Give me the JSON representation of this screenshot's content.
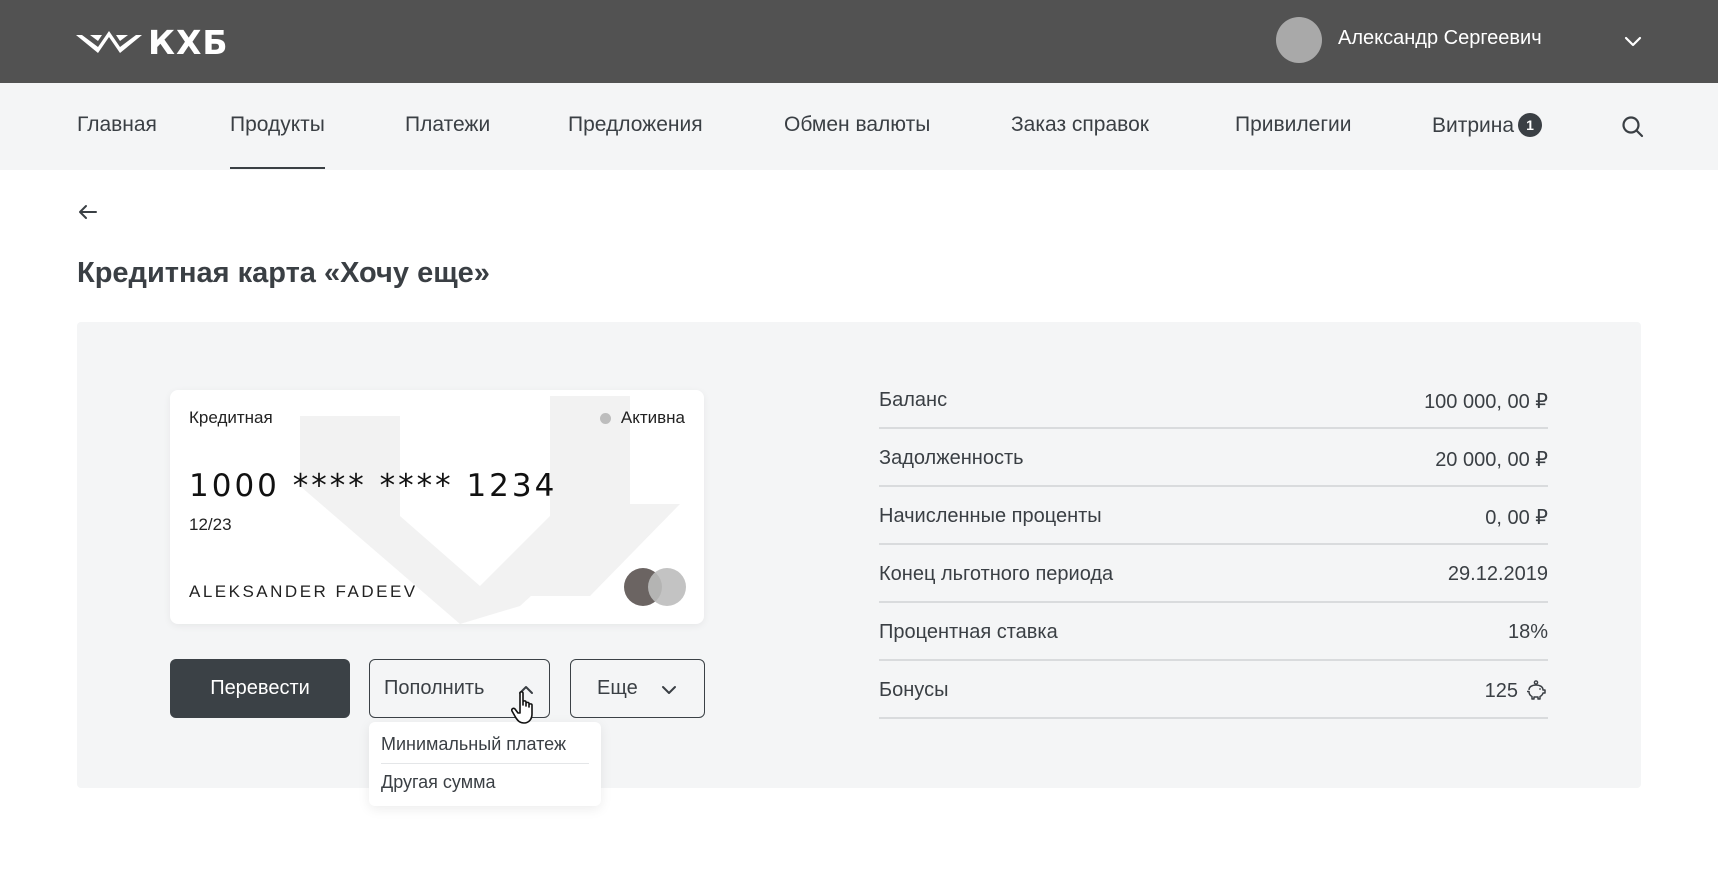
{
  "header": {
    "logo_text": "КХБ",
    "user_name": "Александр Сергеевич"
  },
  "nav": {
    "items": [
      {
        "label": "Главная"
      },
      {
        "label": "Продукты"
      },
      {
        "label": "Платежи"
      },
      {
        "label": "Предложения"
      },
      {
        "label": "Обмен валюты"
      },
      {
        "label": "Заказ справок"
      },
      {
        "label": "Привилегии"
      },
      {
        "label": "Витрина"
      }
    ],
    "showcase_badge": "1",
    "active": "Продукты"
  },
  "page": {
    "title": "Кредитная карта «Хочу еще»"
  },
  "card": {
    "type": "Кредитная",
    "status": "Активна",
    "number": "1000 **** **** 1234",
    "expiry": "12/23",
    "holder": "ALEKSANDER FADEEV",
    "payment_system_icon": "mastercard-icon"
  },
  "actions": {
    "transfer": "Перевести",
    "top_up": "Пополнить",
    "more": "Еще"
  },
  "top_up_menu": {
    "items": [
      "Минимальный платеж",
      "Другая сумма"
    ]
  },
  "info": {
    "rows": [
      {
        "label": "Баланс",
        "value": "100 000, 00 ₽"
      },
      {
        "label": "Задолженность",
        "value": "20 000, 00 ₽"
      },
      {
        "label": "Начисленные проценты",
        "value": "0, 00 ₽"
      },
      {
        "label": "Конец льготного периода",
        "value": "29.12.2019"
      },
      {
        "label": "Процентная ставка",
        "value": "18%"
      },
      {
        "label": "Бонусы",
        "value": "125"
      }
    ]
  },
  "colors": {
    "header_bg": "#525252",
    "nav_bg": "#f4f5f6",
    "panel_bg": "#f4f5f6",
    "primary_button": "#3b4146",
    "text": "#3a3f44"
  }
}
